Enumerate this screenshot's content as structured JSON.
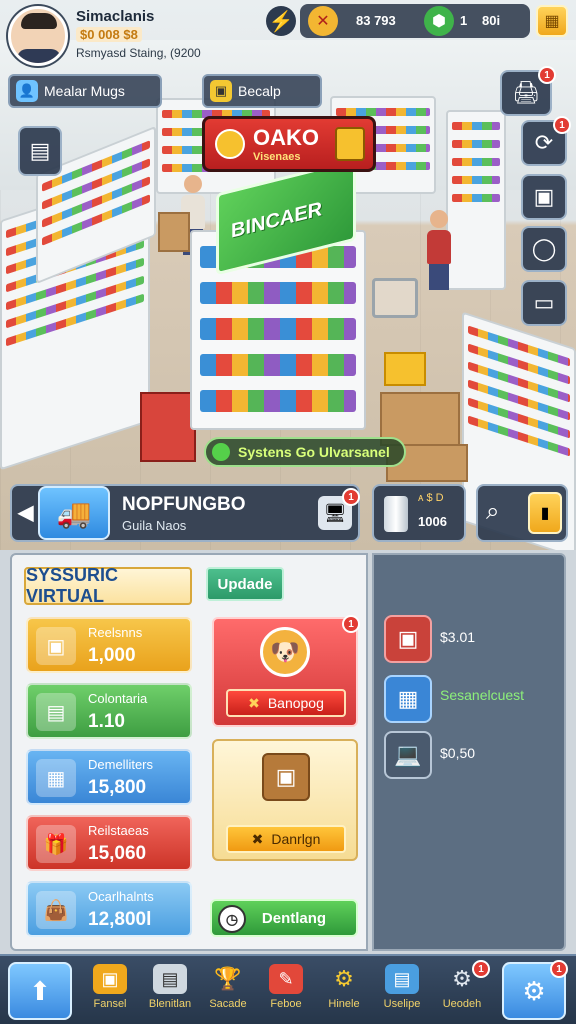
{
  "player": {
    "name": "Simaclanis",
    "money": "$0 008 $8",
    "subtitle": "Rsmyasd Staing, (9200"
  },
  "resources": [
    {
      "icon": "coin-icon",
      "value": "83 793"
    },
    {
      "icon": "gem-icon",
      "value": "1"
    },
    {
      "icon": "cash-icon",
      "value": "80i"
    }
  ],
  "top_pills": {
    "left_label": "Mealar Mugs",
    "center_label": "Becalp"
  },
  "store_sign": {
    "title": "OAKO",
    "subtitle": "Visenaes"
  },
  "display_banner": "BINCAER",
  "toast": "Systens Go Ulvarsanel",
  "info_bar": {
    "title": "NOPFUNGBO",
    "subtitle": "Guila Naos"
  },
  "stat_box": {
    "top": "ᴀ $ D",
    "value": "1006"
  },
  "panel": {
    "title": "SYSSURIC VIRTUAL",
    "update_label": "Updade",
    "cards": [
      {
        "label": "Reelsnns",
        "value": "1,000",
        "color": "#f3b632",
        "icon": "box-icon"
      },
      {
        "label": "Colontaria",
        "value": "1.10",
        "color": "#55b85a",
        "icon": "case-icon"
      },
      {
        "label": "Demelliters",
        "value": "15,800",
        "color": "#4a9ee6",
        "icon": "crate-icon"
      },
      {
        "label": "Reilstaeas",
        "value": "15,060",
        "color": "#e2483a",
        "icon": "gift-icon"
      },
      {
        "label": "Ocarlhalnts",
        "value": "12,800l",
        "color": "#62b0e8",
        "icon": "bag-icon"
      }
    ],
    "red_card_button": "Banopog",
    "yellow_card_button": "Danrlgn",
    "green_button": "Dentlang"
  },
  "side_panel": [
    {
      "icon": "red-box-icon",
      "text": "$3.01"
    },
    {
      "icon": "blue-box-icon",
      "text": "Sesanelcuest"
    },
    {
      "icon": "laptop-icon",
      "text": "$0,50"
    }
  ],
  "bottom_nav": [
    {
      "label": "Fansel",
      "icon": "home-icon"
    },
    {
      "label": "Blenitlan",
      "icon": "barrel-icon"
    },
    {
      "label": "Sacade",
      "icon": "trophy-icon"
    },
    {
      "label": "Feboe",
      "icon": "tag-icon"
    },
    {
      "label": "Hinele",
      "icon": "gear-icon"
    },
    {
      "label": "Uselipe",
      "icon": "report-icon"
    },
    {
      "label": "Ueodeh",
      "icon": "cog-icon"
    }
  ],
  "notification_count": "1",
  "colors": {
    "hud_dark": "#2c3a4e",
    "accent_gold": "#f0a81c",
    "accent_green": "#2f9a3a",
    "accent_red": "#d23838"
  }
}
